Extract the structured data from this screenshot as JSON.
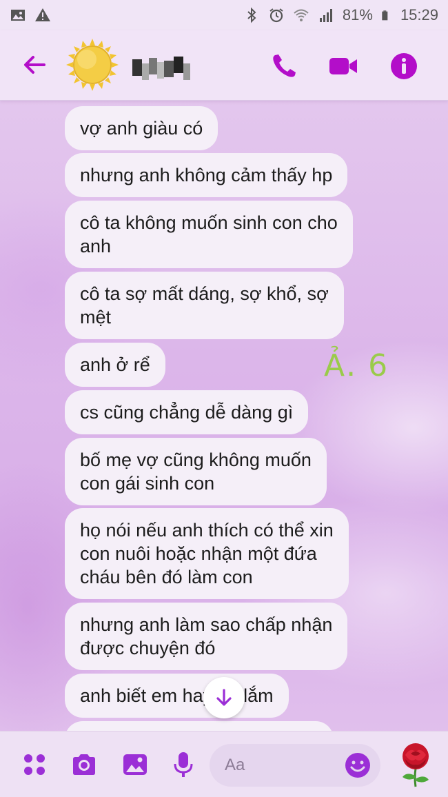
{
  "status_bar": {
    "battery": "81%",
    "time": "15:29",
    "icons": [
      "image-notification-icon",
      "warning-icon",
      "bluetooth-icon",
      "alarm-icon",
      "wifi-icon",
      "signal-icon",
      "battery-icon"
    ]
  },
  "header": {
    "back_icon": "back-arrow-icon",
    "avatar": "sun-avatar",
    "contact_name_hidden": true,
    "actions": [
      "phone-icon",
      "video-icon",
      "info-icon"
    ]
  },
  "messages": [
    {
      "text": "vợ anh giàu có"
    },
    {
      "text": "nhưng anh không cảm thấy hp"
    },
    {
      "text": "cô ta không muốn sinh con cho\nanh"
    },
    {
      "text": "cô ta sợ mất dáng, sợ khổ, sợ\nmệt"
    },
    {
      "text": "anh ở rể"
    },
    {
      "text": "cs cũng chẳng dễ dàng gì"
    },
    {
      "text": "bố mẹ vợ cũng không muốn\ncon gái sinh con"
    },
    {
      "text": "họ nói nếu anh thích có thể xin\ncon nuôi hoặc nhận một đứa\ncháu bên đó làm con"
    },
    {
      "text": "nhưng anh làm sao chấp nhận\nđược chuyện đó"
    },
    {
      "text": "anh biết em hay       nh lắm"
    }
  ],
  "annotation": "Ả. 6",
  "composer": {
    "placeholder": "Aa",
    "buttons": [
      "menu-dots-icon",
      "camera-icon",
      "gallery-icon",
      "microphone-icon",
      "emoji-icon",
      "rose-icon"
    ]
  },
  "colors": {
    "accent": "#b30ec9",
    "bubble": "#f5eff8",
    "annotation": "#9acb4a"
  }
}
